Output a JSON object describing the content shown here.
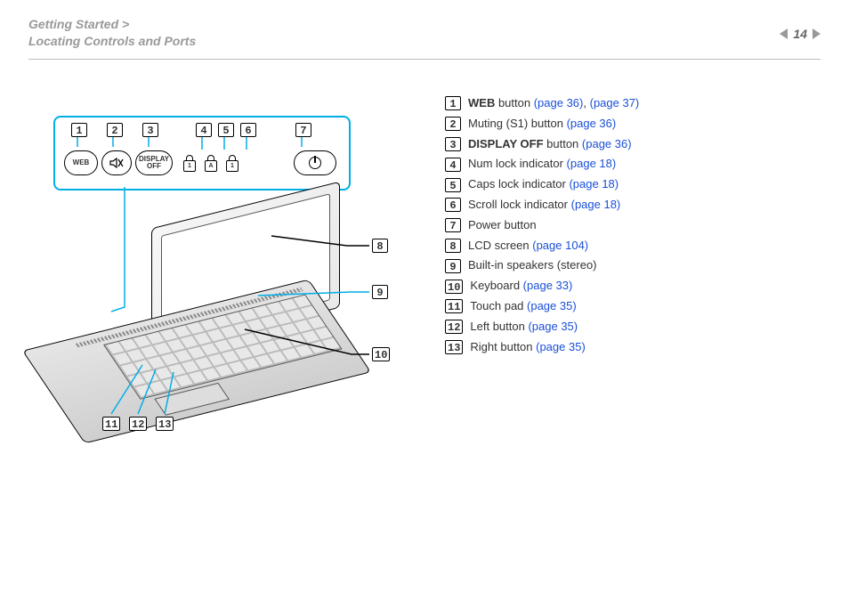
{
  "header": {
    "breadcrumb_line1": "Getting Started >",
    "breadcrumb_line2": "Locating Controls and Ports",
    "page_number": "14",
    "locks": {
      "l1": "1",
      "l2": "A",
      "l3": "1"
    }
  },
  "panel": {
    "web_label": "WEB",
    "display_off_l1": "DISPLAY",
    "display_off_l2": "OFF"
  },
  "callouts": {
    "n1": "1",
    "n2": "2",
    "n3": "3",
    "n4": "4",
    "n5": "5",
    "n6": "6",
    "n7": "7",
    "n8": "8",
    "n9": "9",
    "n10": "10",
    "n11": "11",
    "n12": "12",
    "n13": "13"
  },
  "legend": [
    {
      "num": "1",
      "pre_bold": "WEB",
      "text": " button ",
      "links": [
        "(page 36)",
        ", ",
        "(page 37)"
      ]
    },
    {
      "num": "2",
      "pre_bold": "",
      "text": "Muting (S1) button ",
      "links": [
        "(page 36)"
      ]
    },
    {
      "num": "3",
      "pre_bold": "DISPLAY OFF",
      "text": " button ",
      "links": [
        "(page 36)"
      ]
    },
    {
      "num": "4",
      "pre_bold": "",
      "text": "Num lock indicator ",
      "links": [
        "(page 18)"
      ]
    },
    {
      "num": "5",
      "pre_bold": "",
      "text": "Caps lock indicator ",
      "links": [
        "(page 18)"
      ]
    },
    {
      "num": "6",
      "pre_bold": "",
      "text": "Scroll lock indicator ",
      "links": [
        "(page 18)"
      ]
    },
    {
      "num": "7",
      "pre_bold": "",
      "text": "Power button",
      "links": []
    },
    {
      "num": "8",
      "pre_bold": "",
      "text": "LCD screen ",
      "links": [
        "(page 104)"
      ]
    },
    {
      "num": "9",
      "pre_bold": "",
      "text": "Built-in speakers (stereo)",
      "links": []
    },
    {
      "num": "10",
      "pre_bold": "",
      "text": "Keyboard ",
      "links": [
        "(page 33)"
      ]
    },
    {
      "num": "11",
      "pre_bold": "",
      "text": "Touch pad ",
      "links": [
        "(page 35)"
      ]
    },
    {
      "num": "12",
      "pre_bold": "",
      "text": "Left button ",
      "links": [
        "(page 35)"
      ]
    },
    {
      "num": "13",
      "pre_bold": "",
      "text": "Right button ",
      "links": [
        "(page 35)"
      ]
    }
  ]
}
